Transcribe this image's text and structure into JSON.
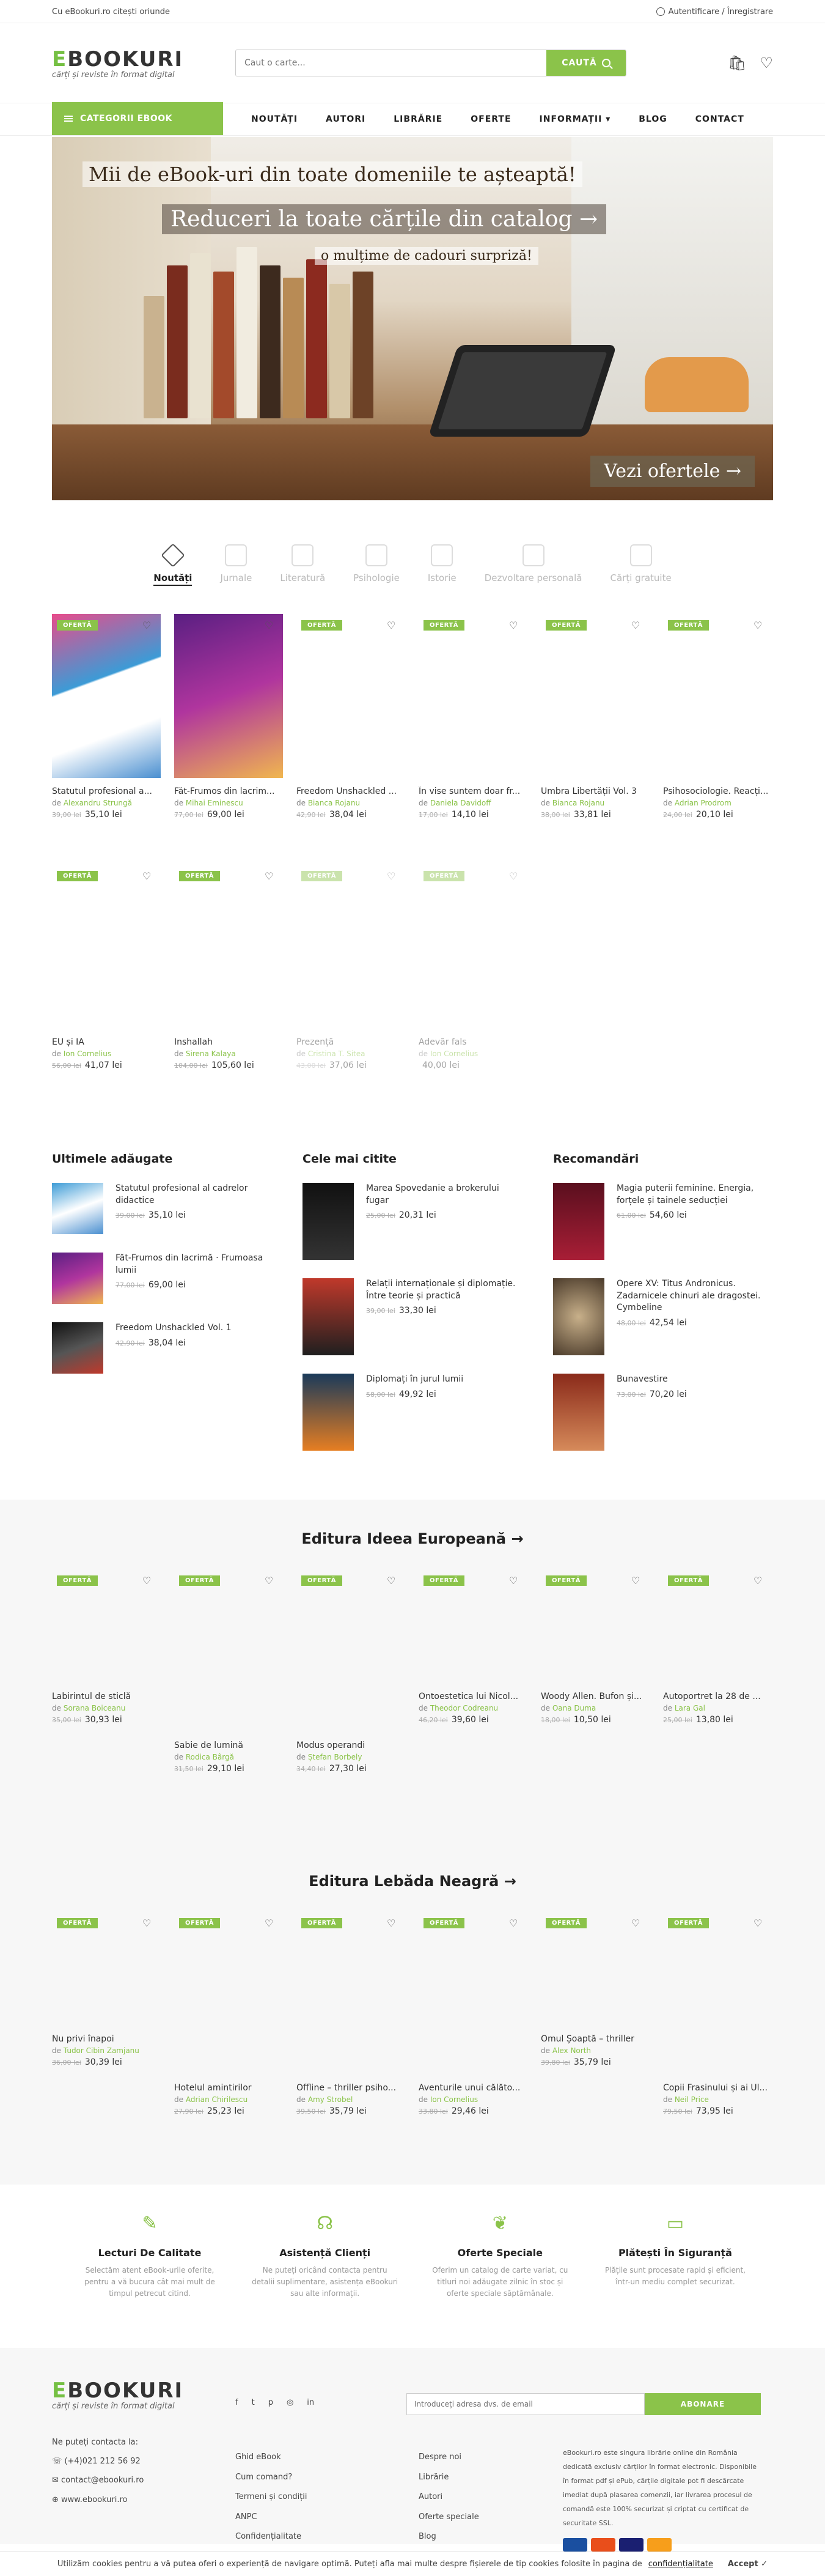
{
  "topbar": {
    "left": "Cu eBookuri.ro citești oriunde",
    "auth": "Autentificare / Înregistrare"
  },
  "logo": {
    "brand_e": "E",
    "brand_rest": "BOOKURI",
    "tagline": "cărți și reviste în format digital"
  },
  "search": {
    "placeholder": "Caut o carte...",
    "button": "CAUTĂ"
  },
  "nav": {
    "categories": "CATEGORII EBOOK",
    "items": [
      "NOUTĂȚI",
      "AUTORI",
      "LIBRĂRIE",
      "OFERTE",
      "INFORMAȚII ▾",
      "BLOG",
      "CONTACT"
    ]
  },
  "hero": {
    "line1": "Mii de eBook-uri din toate domeniile te așteaptă!",
    "line2": "Reduceri la toate cărțile din catalog →",
    "line3": "o mulțime de cadouri surpriză!",
    "cta": "Vezi ofertele →"
  },
  "tabs": [
    "Noutăți",
    "Jurnale",
    "Literatură",
    "Psihologie",
    "Istorie",
    "Dezvoltare personală",
    "Cărți gratuite"
  ],
  "badge": "OFERTĂ",
  "by": "de",
  "products": [
    {
      "title": "Statutul profesional a...",
      "author": "Alexandru Strungă",
      "old": "39,00 lei",
      "price": "35,10 lei",
      "badge": true
    },
    {
      "title": "Făt-Frumos din lacrim...",
      "author": "Mihai Eminescu",
      "old": "77,00 lei",
      "price": "69,00 lei",
      "badge": false
    },
    {
      "title": "Freedom Unshackled ...",
      "author": "Bianca Rojanu",
      "old": "42,90 lei",
      "price": "38,04 lei",
      "badge": true
    },
    {
      "title": "În vise suntem doar fr...",
      "author": "Daniela Davidoff",
      "old": "17,00 lei",
      "price": "14,10 lei",
      "badge": true
    },
    {
      "title": "Umbra Libertății Vol. 3",
      "author": "Bianca Rojanu",
      "old": "38,00 lei",
      "price": "33,81 lei",
      "badge": true
    },
    {
      "title": "Psihosociologie. Reacți...",
      "author": "Adrian Prodrom",
      "old": "24,00 lei",
      "price": "20,10 lei",
      "badge": true
    },
    {
      "title": "EU și IA",
      "author": "Ion Cornelius",
      "old": "56,00 lei",
      "price": "41,07 lei",
      "badge": true
    },
    {
      "title": "Inshallah",
      "author": "Sirena Kalaya",
      "old": "104,00 lei",
      "price": "105,60 lei",
      "badge": true
    },
    {
      "title": "Prezență",
      "author": "Cristina T. Sitea",
      "old": "43,00 lei",
      "price": "37,06 lei",
      "badge": true
    },
    {
      "title": "Adevăr fals",
      "author": "Ion Cornelius",
      "old": "",
      "price": "40,00 lei",
      "badge": true
    },
    {
      "title": "",
      "author": "",
      "old": "",
      "price": "",
      "badge": false
    },
    {
      "title": "",
      "author": "",
      "old": "",
      "price": "",
      "badge": false
    }
  ],
  "columns": [
    {
      "heading": "Ultimele adăugate",
      "items": [
        {
          "title": "Statutul profesional al cadrelor didactice",
          "old": "39,00 lei",
          "price": "35,10 lei"
        },
        {
          "title": "Făt-Frumos din lacrimă · Frumoasa lumii",
          "old": "77,00 lei",
          "price": "69,00 lei"
        },
        {
          "title": "Freedom Unshackled Vol. 1",
          "old": "42,90 lei",
          "price": "38,04 lei"
        }
      ]
    },
    {
      "heading": "Cele mai citite",
      "items": [
        {
          "title": "Marea Spovedanie a brokerului fugar",
          "old": "25,00 lei",
          "price": "20,31 lei"
        },
        {
          "title": "Relații internaționale și diplomație. Între teorie și practică",
          "old": "39,00 lei",
          "price": "33,30 lei"
        },
        {
          "title": "Diplomați în jurul lumii",
          "old": "58,00 lei",
          "price": "49,92 lei"
        }
      ]
    },
    {
      "heading": "Recomandări",
      "items": [
        {
          "title": "Magia puterii feminine. Energia, forțele și tainele seducției",
          "old": "61,00 lei",
          "price": "54,60 lei"
        },
        {
          "title": "Opere XV: Titus Andronicus. Zadarnicele chinuri ale dragostei. Cymbeline",
          "old": "48,00 lei",
          "price": "42,54 lei"
        },
        {
          "title": "Bunavestire",
          "old": "73,00 lei",
          "price": "70,20 lei"
        }
      ]
    }
  ],
  "publishers": [
    {
      "heading": "Editura Ideea Europeană →",
      "items": [
        {
          "title": "Labirintul de sticlă",
          "author": "Sorana Boiceanu",
          "old": "35,00 lei",
          "price": "30,93 lei",
          "row": 1
        },
        {
          "title": "Sabie de lumină",
          "author": "Rodica Bârgă",
          "old": "31,50 lei",
          "price": "29,10 lei",
          "row": 2
        },
        {
          "title": "Modus operandi",
          "author": "Ștefan Borbely",
          "old": "34,40 lei",
          "price": "27,30 lei",
          "row": 2
        },
        {
          "title": "Ontoestetica lui Nicol...",
          "author": "Theodor Codreanu",
          "old": "46,20 lei",
          "price": "39,60 lei",
          "row": 1
        },
        {
          "title": "Woody Allen. Bufon și...",
          "author": "Oana Duma",
          "old": "18,00 lei",
          "price": "10,50 lei",
          "row": 1
        },
        {
          "title": "Autoportret la 28 de ...",
          "author": "Lara Gal",
          "old": "25,00 lei",
          "price": "13,80 lei",
          "row": 1
        }
      ]
    },
    {
      "heading": "Editura Lebăda Neagră →",
      "items": [
        {
          "title": "Nu privi înapoi",
          "author": "Tudor Cibin Zamjanu",
          "old": "36,00 lei",
          "price": "30,39 lei",
          "row": 1
        },
        {
          "title": "Hotelul amintirilor",
          "author": "Adrian Chirilescu",
          "old": "27,90 lei",
          "price": "25,23 lei",
          "row": 2
        },
        {
          "title": "Offline – thriller psiho...",
          "author": "Amy Strobel",
          "old": "39,50 lei",
          "price": "35,79 lei",
          "row": 2
        },
        {
          "title": "Aventurile unui călăto...",
          "author": "Ion Cornelius",
          "old": "33,80 lei",
          "price": "29,46 lei",
          "row": 2
        },
        {
          "title": "Omul Șoaptă – thriller",
          "author": "Alex North",
          "old": "39,80 lei",
          "price": "35,79 lei",
          "row": 1
        },
        {
          "title": "Copii Frasinului și ai Ul...",
          "author": "Neil Price",
          "old": "79,50 lei",
          "price": "73,95 lei",
          "row": 2
        }
      ]
    }
  ],
  "features": [
    {
      "title": "Lecturi De Calitate",
      "text": "Selectăm atent eBook-urile oferite, pentru a vă bucura cât mai mult de timpul petrecut citind."
    },
    {
      "title": "Asistență Clienți",
      "text": "Ne puteți oricând contacta pentru detalii suplimentare, asistența eBookuri sau alte informații."
    },
    {
      "title": "Oferte Speciale",
      "text": "Oferim un catalog de carte variat, cu titluri noi adăugate zilnic în stoc și oferte speciale săptămânale."
    },
    {
      "title": "Plătești În Siguranță",
      "text": "Plățile sunt procesate rapid și eficient, într-un mediu complet securizat."
    }
  ],
  "footer": {
    "contact_label": "Ne puteți contacta la:",
    "phone": "(+4)021 212 56 92",
    "email": "contact@ebookuri.ro",
    "site": "www.ebookuri.ro",
    "social": [
      "f",
      "t",
      "p",
      "◎",
      "in"
    ],
    "links1": [
      "Ghid eBook",
      "Cum comand?",
      "Termeni și condiții",
      "ANPC",
      "Confidențialitate"
    ],
    "links2": [
      "Despre noi",
      "Librărie",
      "Autori",
      "Oferte speciale",
      "Blog"
    ],
    "newsletter_placeholder": "Introduceți adresa dvs. de email",
    "newsletter_button": "ABONARE",
    "description": "eBookuri.ro este singura librărie online din România dedicată exclusiv cărților în format electronic. Disponibile în format pdf și ePub, cărțile digitale pot fi descărcate imediat după plasarea comenzii, iar livrarea procesul de comandă este 100% securizat și criptat cu certificat de securitate SSL."
  },
  "cookie": {
    "text": "Utilizăm cookies pentru a vă putea oferi o experiență de navigare optimă. Puteți afla mai multe despre fișierele de tip cookies folosite în pagina de",
    "link": "confidențialitate",
    "accept": "Accept ✓"
  }
}
